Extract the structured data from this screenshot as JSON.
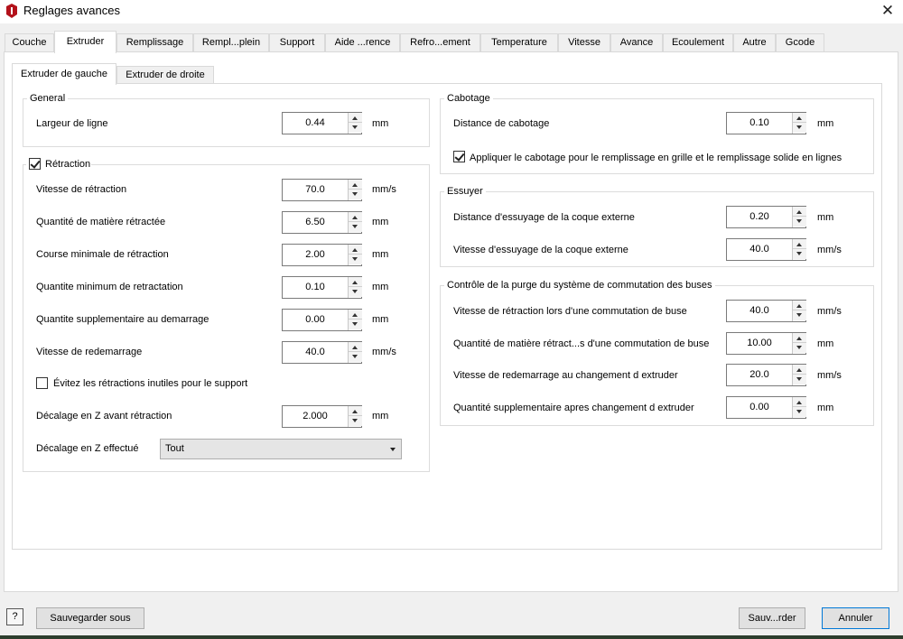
{
  "window": {
    "title": "Reglages avances",
    "close_glyph": "✕",
    "icon": "app-logo-icon",
    "accent": "#0078d7"
  },
  "tabs": [
    {
      "label": "Couche"
    },
    {
      "label": "Extruder",
      "active": true
    },
    {
      "label": "Remplissage"
    },
    {
      "label": "Rempl...plein"
    },
    {
      "label": "Support"
    },
    {
      "label": "Aide ...rence"
    },
    {
      "label": "Refro...ement"
    },
    {
      "label": "Temperature"
    },
    {
      "label": "Vitesse"
    },
    {
      "label": "Avance"
    },
    {
      "label": "Ecoulement"
    },
    {
      "label": "Autre"
    },
    {
      "label": "Gcode"
    }
  ],
  "subtabs": [
    {
      "label": "Extruder de gauche",
      "active": true
    },
    {
      "label": "Extruder de droite"
    }
  ],
  "general": {
    "title": "General",
    "line_width_label": "Largeur de ligne",
    "line_width_value": "0.44",
    "line_width_unit": "mm"
  },
  "retraction": {
    "title": "Rétraction",
    "enabled": true,
    "fields": [
      {
        "label": "Vitesse de rétraction",
        "value": "70.0",
        "unit": "mm/s"
      },
      {
        "label": "Quantité de matière rétractée",
        "value": "6.50",
        "unit": "mm"
      },
      {
        "label": "Course minimale de rétraction",
        "value": "2.00",
        "unit": "mm"
      },
      {
        "label": "Quantite minimum de retractation",
        "value": "0.10",
        "unit": "mm"
      },
      {
        "label": "Quantite supplementaire au demarrage",
        "value": "0.00",
        "unit": "mm"
      },
      {
        "label": "Vitesse de redemarrage",
        "value": "40.0",
        "unit": "mm/s"
      }
    ],
    "avoid_label": "Évitez les rétractions inutiles pour le support",
    "avoid_checked": false,
    "zhop_label": "Décalage en Z avant rétraction",
    "zhop_value": "2.000",
    "zhop_unit": "mm",
    "zhop_mode_label": "Décalage en Z effectué",
    "zhop_mode_value": "Tout"
  },
  "coasting": {
    "title": "Cabotage",
    "distance_label": "Distance de cabotage",
    "distance_value": "0.10",
    "distance_unit": "mm",
    "apply_label": "Appliquer le cabotage pour le remplissage en grille et le remplissage solide en lignes",
    "apply_checked": true
  },
  "wipe": {
    "title": "Essuyer",
    "fields": [
      {
        "label": "Distance d'essuyage de la coque externe",
        "value": "0.20",
        "unit": "mm"
      },
      {
        "label": "Vitesse d'essuyage de la coque externe",
        "value": "40.0",
        "unit": "mm/s"
      }
    ]
  },
  "purge": {
    "title": "Contrôle de la purge du système de commutation des buses",
    "fields": [
      {
        "label": "Vitesse de rétraction lors d'une commutation de buse",
        "value": "40.0",
        "unit": "mm/s"
      },
      {
        "label": "Quantité de matière rétract...s d'une commutation de buse",
        "value": "10.00",
        "unit": "mm"
      },
      {
        "label": "Vitesse de redemarrage au changement d extruder",
        "value": "20.0",
        "unit": "mm/s"
      },
      {
        "label": "Quantité supplementaire apres changement d extruder",
        "value": "0.00",
        "unit": "mm"
      }
    ]
  },
  "footer": {
    "help_label": "?",
    "save_as_label": "Sauvegarder sous",
    "save_label": "Sauv...rder",
    "cancel_label": "Annuler"
  }
}
